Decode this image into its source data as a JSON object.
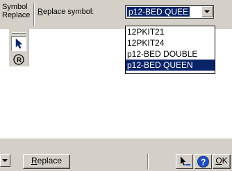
{
  "panel": {
    "group_label_line1": "Symbol",
    "group_label_line2": "Replace",
    "replace_label": "Replace symbol:",
    "replace_label_access": "R",
    "replace_label_rest": "eplace symbol:"
  },
  "combo": {
    "value": "p12-BED QUEE"
  },
  "dropdown": {
    "options": [
      "12PKIT21",
      "12PKIT24",
      "p12-BED DOUBLE",
      "p12-BED QUEEN"
    ],
    "selected_index": 3
  },
  "toolbox": {
    "tools": [
      "select-arrow-icon",
      "rotate-icon"
    ]
  },
  "bottom_bar": {
    "replace_button_access": "R",
    "replace_button_rest": "eplace",
    "ok_access": "O",
    "ok_rest": "K"
  },
  "colors": {
    "face": "#d4d0c8",
    "highlight": "#0a246a",
    "help_blue": "#1a4fc4"
  }
}
